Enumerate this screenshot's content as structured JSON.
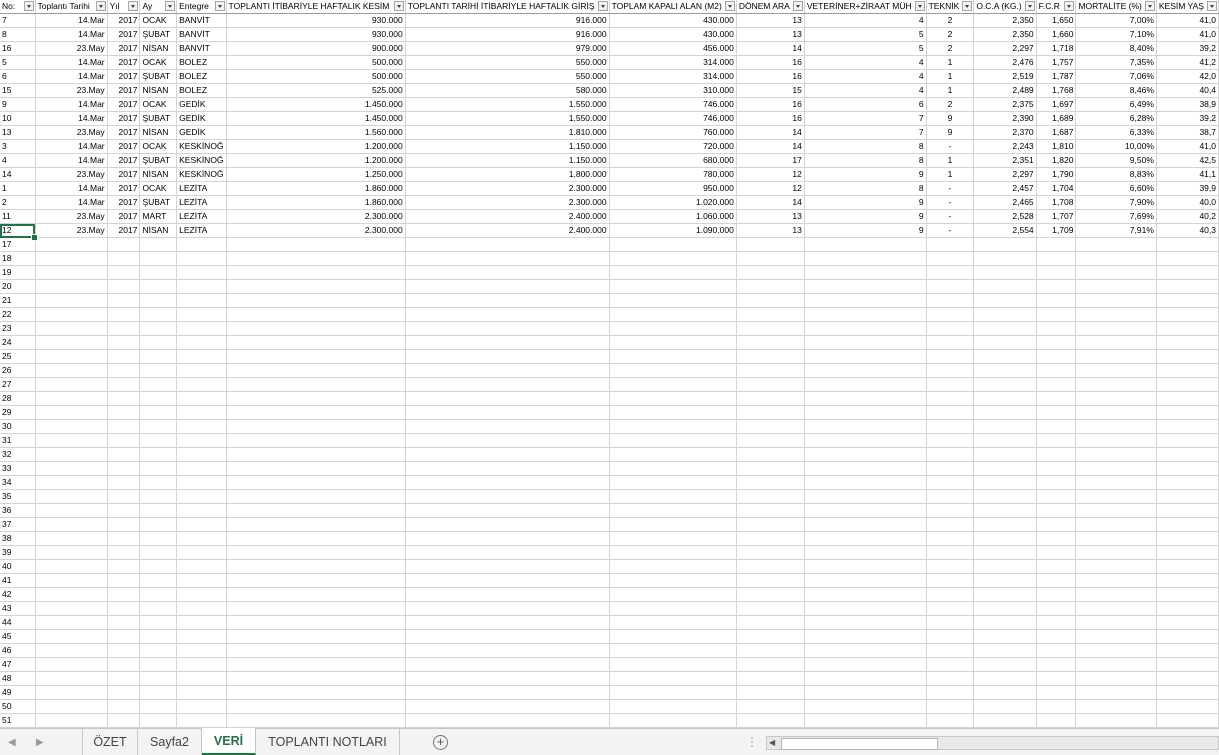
{
  "headers": [
    "No:",
    "Toplantı Tarihi",
    "Yıl",
    "Ay",
    "Entegre",
    "TOPLANTI İTİBARİYLE HAFTALIK KESİM",
    "TOPLANTI TARİHİ İTİBARİYLE  HAFTALIK GİRİŞ",
    "TOPLAM KAPALI ALAN (M2)",
    "DÖNEM ARA",
    "VETERİNER+ZİRAAT MÜH",
    "TEKNİK",
    "O.C.A (KG.)",
    "F.C.R",
    "MORTALİTE (%)",
    "KESİM YAŞ"
  ],
  "rows": [
    [
      "7",
      "14.Mar",
      "2017",
      "OCAK",
      "BANVİT",
      "930.000",
      "916.000",
      "430.000",
      "13",
      "4",
      "2",
      "2,350",
      "1,650",
      "7,00%",
      "41,0"
    ],
    [
      "8",
      "14.Mar",
      "2017",
      "ŞUBAT",
      "BANVİT",
      "930.000",
      "916.000",
      "430.000",
      "13",
      "5",
      "2",
      "2,350",
      "1,660",
      "7,10%",
      "41,0"
    ],
    [
      "16",
      "23.May",
      "2017",
      "NİSAN",
      "BANVİT",
      "900.000",
      "979.000",
      "456.000",
      "14",
      "5",
      "2",
      "2,297",
      "1,718",
      "8,40%",
      "39,2"
    ],
    [
      "5",
      "14.Mar",
      "2017",
      "OCAK",
      "BOLEZ",
      "500.000",
      "550.000",
      "314.000",
      "16",
      "4",
      "1",
      "2,476",
      "1,757",
      "7,35%",
      "41,2"
    ],
    [
      "6",
      "14.Mar",
      "2017",
      "ŞUBAT",
      "BOLEZ",
      "500.000",
      "550.000",
      "314.000",
      "16",
      "4",
      "1",
      "2,519",
      "1,787",
      "7,06%",
      "42,0"
    ],
    [
      "15",
      "23.May",
      "2017",
      "NİSAN",
      "BOLEZ",
      "525.000",
      "580.000",
      "310.000",
      "15",
      "4",
      "1",
      "2,489",
      "1,768",
      "8,46%",
      "40,4"
    ],
    [
      "9",
      "14.Mar",
      "2017",
      "OCAK",
      "GEDİK",
      "1.450.000",
      "1.550.000",
      "746.000",
      "16",
      "6",
      "2",
      "2,375",
      "1,697",
      "6,49%",
      "38,9"
    ],
    [
      "10",
      "14.Mar",
      "2017",
      "ŞUBAT",
      "GEDİK",
      "1.450.000",
      "1.550.000",
      "746.000",
      "16",
      "7",
      "9",
      "2,390",
      "1,689",
      "6,28%",
      "39,2"
    ],
    [
      "13",
      "23.May",
      "2017",
      "NİSAN",
      "GEDİK",
      "1.560.000",
      "1.810.000",
      "760.000",
      "14",
      "7",
      "9",
      "2,370",
      "1,687",
      "6,33%",
      "38,7"
    ],
    [
      "3",
      "14.Mar",
      "2017",
      "OCAK",
      "KESKİNOĞ",
      "1.200.000",
      "1.150.000",
      "720.000",
      "14",
      "8",
      "-",
      "2,243",
      "1,810",
      "10,00%",
      "41,0"
    ],
    [
      "4",
      "14.Mar",
      "2017",
      "ŞUBAT",
      "KESKİNOĞ",
      "1.200.000",
      "1.150.000",
      "680.000",
      "17",
      "8",
      "1",
      "2,351",
      "1,820",
      "9,50%",
      "42,5"
    ],
    [
      "14",
      "23.May",
      "2017",
      "NİSAN",
      "KESKİNOĞ",
      "1.250.000",
      "1.800.000",
      "780.000",
      "12",
      "9",
      "1",
      "2,297",
      "1,790",
      "8,83%",
      "41,1"
    ],
    [
      "1",
      "14.Mar",
      "2017",
      "OCAK",
      "LEZİTA",
      "1.860.000",
      "2.300.000",
      "950.000",
      "12",
      "8",
      "-",
      "2,457",
      "1,704",
      "6,60%",
      "39,9"
    ],
    [
      "2",
      "14.Mar",
      "2017",
      "ŞUBAT",
      "LEZİTA",
      "1.860.000",
      "2.300.000",
      "1.020.000",
      "14",
      "9",
      "-",
      "2,465",
      "1,708",
      "7,90%",
      "40,0"
    ],
    [
      "11",
      "23.May",
      "2017",
      "MART",
      "LEZİTA",
      "2.300.000",
      "2.400.000",
      "1.060.000",
      "13",
      "9",
      "-",
      "2,528",
      "1,707",
      "7,69%",
      "40,2"
    ],
    [
      "12",
      "23.May",
      "2017",
      "NİSAN",
      "LEZİTA",
      "2.300.000",
      "2.400.000",
      "1.090.000",
      "13",
      "9",
      "-",
      "2,554",
      "1,709",
      "7,91%",
      "40,3"
    ]
  ],
  "empty_rows": [
    "17",
    "18",
    "19",
    "20",
    "21",
    "22",
    "23",
    "24",
    "25",
    "26",
    "27",
    "28",
    "29",
    "30",
    "31",
    "32",
    "33",
    "34",
    "35",
    "36",
    "37",
    "38",
    "39",
    "40",
    "41",
    "42",
    "43",
    "44",
    "45",
    "46",
    "47",
    "48",
    "49",
    "50",
    "51"
  ],
  "tabs": [
    "ÖZET",
    "Sayfa2",
    "VERİ",
    "TOPLANTI NOTLARI"
  ],
  "active_tab": "VERİ",
  "icons": {
    "nav_prev": "◀",
    "nav_next": "▶",
    "add_sheet": "+",
    "more": "⋮",
    "scroll_left": "◀"
  },
  "colors": {
    "accent": "#217346",
    "grid": "#d4d4d4"
  }
}
